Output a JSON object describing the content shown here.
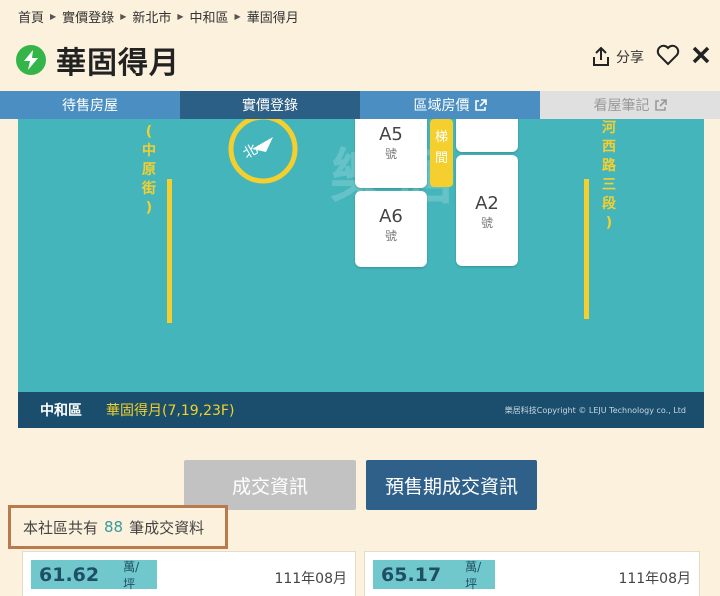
{
  "breadcrumb": [
    "首頁",
    "實價登錄",
    "新北市",
    "中和區",
    "華固得月"
  ],
  "page_title": "華固得月",
  "actions": {
    "share_label": "分享"
  },
  "tabs": [
    {
      "label": "待售房屋",
      "state": "normal"
    },
    {
      "label": "實價登錄",
      "state": "active"
    },
    {
      "label": "區域房價",
      "state": "normal"
    },
    {
      "label": "看屋筆記",
      "state": "disabled"
    }
  ],
  "map": {
    "road_left": "中原街",
    "road_right": "河西路三段",
    "stair_label": "梯間",
    "compass_label": "北",
    "watermark": "樂居",
    "units": [
      {
        "id": "A5",
        "num": "號"
      },
      {
        "id": "A6",
        "num": "號"
      },
      {
        "id": "A2",
        "num": "號"
      }
    ],
    "footer_district": "中和區",
    "footer_building": "華固得月(7,19,23F)",
    "footer_copyright": "樂居科技Copyright © LEJU Technology co., Ltd"
  },
  "buttons": {
    "deal_info": "成交資訊",
    "presale_info": "預售期成交資訊"
  },
  "count": {
    "prefix": "本社區共有",
    "value": "88",
    "suffix": "筆成交資料"
  },
  "cards": [
    {
      "price": "61.62",
      "unit": "萬/坪",
      "date": "111年08月"
    },
    {
      "price": "65.17",
      "unit": "萬/坪",
      "date": "111年08月"
    }
  ],
  "colors": {
    "accent": "#2e6089",
    "tab": "#4b8fc2",
    "map": "#44b6bb",
    "road": "#f4cf2e",
    "highlight_border": "#b97a4e"
  }
}
